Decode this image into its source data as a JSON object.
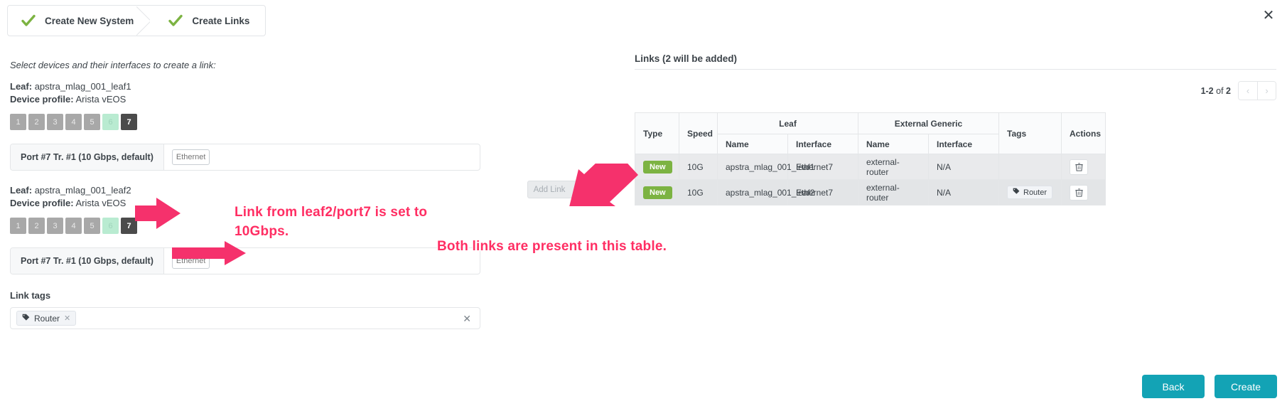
{
  "wizard": {
    "steps": [
      {
        "label": "Create New System",
        "icon": "check-icon"
      },
      {
        "label": "Create Links",
        "icon": "check-icon"
      }
    ]
  },
  "close": {
    "icon": "close-icon",
    "glyph": "✕"
  },
  "left": {
    "hint": "Select devices and their interfaces to create a link:",
    "devices": [
      {
        "leaf_label": "Leaf:",
        "leaf_name": "apstra_mlag_001_leaf1",
        "profile_label": "Device profile:",
        "profile_name": "Arista vEOS",
        "ports": [
          {
            "num": "1",
            "state": "used"
          },
          {
            "num": "2",
            "state": "used"
          },
          {
            "num": "3",
            "state": "used"
          },
          {
            "num": "4",
            "state": "used"
          },
          {
            "num": "5",
            "state": "used"
          },
          {
            "num": "6",
            "state": "available"
          },
          {
            "num": "7",
            "state": "selected"
          }
        ],
        "port_row": {
          "label": "Port #7 Tr. #1 (10 Gbps, default)",
          "iface_value": "",
          "iface_placeholder": "Ethernet7"
        }
      },
      {
        "leaf_label": "Leaf:",
        "leaf_name": "apstra_mlag_001_leaf2",
        "profile_label": "Device profile:",
        "profile_name": "Arista vEOS",
        "ports": [
          {
            "num": "1",
            "state": "used"
          },
          {
            "num": "2",
            "state": "used"
          },
          {
            "num": "3",
            "state": "used"
          },
          {
            "num": "4",
            "state": "used"
          },
          {
            "num": "5",
            "state": "used"
          },
          {
            "num": "6",
            "state": "available"
          },
          {
            "num": "7",
            "state": "selected"
          }
        ],
        "port_row": {
          "label": "Port #7 Tr. #1 (10 Gbps, default)",
          "iface_value": "",
          "iface_placeholder": "Ethernet7"
        }
      }
    ],
    "link_tags": {
      "title": "Link tags",
      "tags": [
        {
          "label": "Router",
          "icon": "tag-icon",
          "remove_icon": "close-icon"
        }
      ],
      "clear_icon": "clear-all-icon",
      "clear_glyph": "✕"
    }
  },
  "add_link": {
    "label": "Add Link",
    "arrow": "→",
    "icon": "arrow-right-icon"
  },
  "right": {
    "title": "Links (2 will be added)",
    "pager": {
      "range": "1-2",
      "of": "of",
      "total": "2",
      "prev_icon": "chevron-left-icon",
      "next_icon": "chevron-right-icon",
      "prev_glyph": "‹",
      "next_glyph": "›"
    },
    "table": {
      "group_headers": {
        "leaf": "Leaf",
        "external": "External Generic"
      },
      "headers": {
        "type": "Type",
        "speed": "Speed",
        "leaf_name": "Name",
        "leaf_interface": "Interface",
        "ext_name": "Name",
        "ext_interface": "Interface",
        "tags": "Tags",
        "actions": "Actions"
      },
      "rows": [
        {
          "type": "New",
          "speed": "10G",
          "leaf_name": "apstra_mlag_001_leaf1",
          "leaf_interface": "Ethernet7",
          "ext_name": "external-router",
          "ext_interface": "N/A",
          "tags": [],
          "action_icon": "trash-icon"
        },
        {
          "type": "New",
          "speed": "10G",
          "leaf_name": "apstra_mlag_001_leaf2",
          "leaf_interface": "Ethernet7",
          "ext_name": "external-router",
          "ext_interface": "N/A",
          "tags": [
            {
              "label": "Router",
              "icon": "tag-icon"
            }
          ],
          "action_icon": "trash-icon"
        }
      ]
    }
  },
  "footer": {
    "back": "Back",
    "create": "Create"
  },
  "annotations": [
    {
      "id": "a1",
      "line1": "Link from leaf2/port7 is set to",
      "line2": "10Gbps."
    },
    {
      "id": "a2",
      "line1": "Both links are present in this table.",
      "line2": ""
    }
  ],
  "colors": {
    "accent": "#13a3b5",
    "badge_new": "#7cb342",
    "annotation": "#ff2e63",
    "port_selected": "#4b4b4b",
    "port_available": "#b9ebd1",
    "port_used": "#a8a8a8"
  }
}
